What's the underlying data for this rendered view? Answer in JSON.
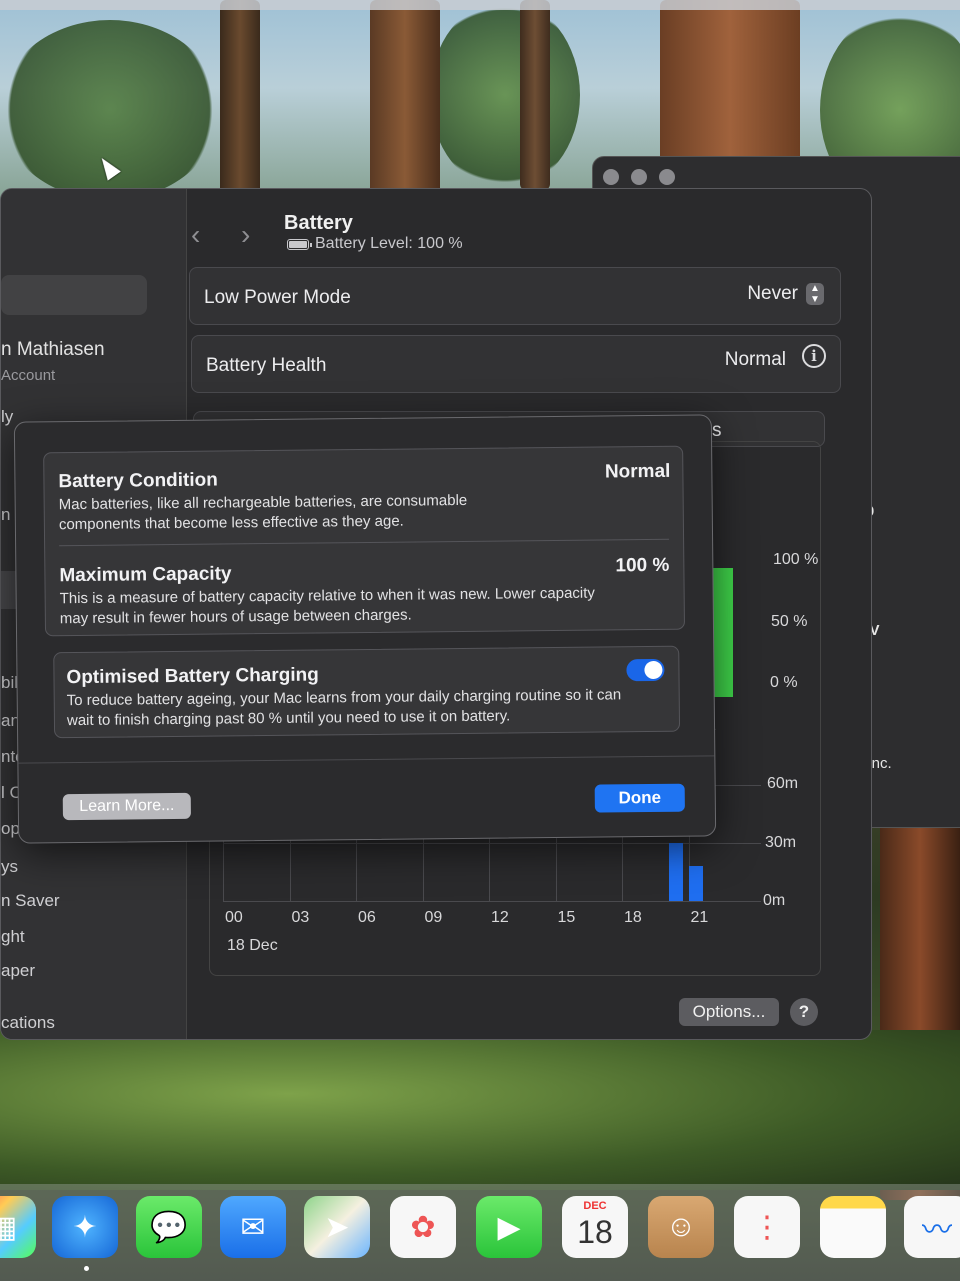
{
  "settings": {
    "page_title": "Battery",
    "battery_level": "Battery Level: 100 %",
    "nav_back": "‹",
    "nav_forward": "›",
    "low_power_mode_label": "Low Power Mode",
    "low_power_mode_value": "Never",
    "battery_health_label": "Battery Health",
    "battery_health_value": "Normal",
    "partial_row_text": "s",
    "options_label": "Options...",
    "help_label": "?"
  },
  "sidebar": {
    "user_name": "n Mathiasen",
    "user_sub": "Account",
    "items": [
      "ly",
      "n",
      "bili",
      "anc",
      "ntel",
      "l Ce",
      "op &",
      "ys",
      "n Saver",
      "ght",
      "aper",
      "cations"
    ]
  },
  "chart_data": [
    {
      "type": "bar",
      "title": "",
      "y_ticks": [
        "100 %",
        "50 %",
        "0 %"
      ],
      "x_tick_visible": "1",
      "series": [
        {
          "values": [
            95,
            95,
            95,
            95
          ]
        }
      ]
    },
    {
      "type": "bar",
      "title": "",
      "categories": [
        "00",
        "03",
        "06",
        "09",
        "12",
        "15",
        "18",
        "21"
      ],
      "date_label": "18 Dec",
      "y_ticks": [
        "60m",
        "30m",
        "0m"
      ],
      "ylim": [
        0,
        60
      ],
      "series": [
        {
          "values": [
            0,
            0,
            0,
            0,
            0,
            0,
            0,
            30
          ]
        }
      ]
    }
  ],
  "sheet": {
    "battery_condition_title": "Battery Condition",
    "battery_condition_value": "Normal",
    "battery_condition_desc": "Mac batteries, like all rechargeable batteries, are consumable components that become less effective as they age.",
    "max_capacity_title": "Maximum Capacity",
    "max_capacity_value": "100 %",
    "max_capacity_desc": "This is a measure of battery capacity relative to when it was new. Lower capacity may result in fewer hours of usage between charges.",
    "optimised_title": "Optimised Battery Charging",
    "optimised_desc": "To reduce battery ageing, your Mac learns from your daily charging routine so it can wait to finish charging past 80 % until you need to use it on battery.",
    "optimised_enabled": true,
    "learn_more_label": "Learn More...",
    "done_label": "Done"
  },
  "back_window": {
    "text_o": "o",
    "text_rv": "RV",
    "text_1": ".1",
    "text_n": "n",
    "text_inc": "e Inc."
  },
  "dock": {
    "apps": [
      "launchpad-icon",
      "safari-icon",
      "messages-icon",
      "mail-icon",
      "maps-icon",
      "photos-icon",
      "facetime-icon",
      "calendar-icon",
      "contacts-icon",
      "reminders-icon",
      "notes-icon",
      "freeform-icon"
    ],
    "calendar_month": "DEC",
    "calendar_day": "18"
  },
  "colors": {
    "accent": "#1f74f2",
    "battery_green": "#3fd24a",
    "usage_blue": "#1f6ef0",
    "window_bg": "#2a2a2c"
  }
}
